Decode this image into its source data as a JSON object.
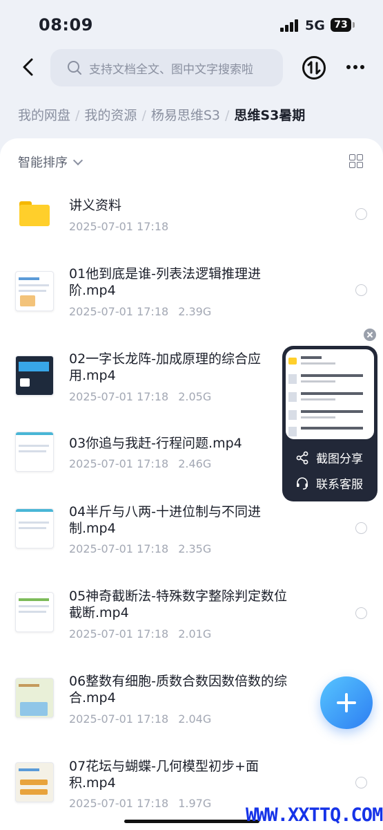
{
  "status_bar": {
    "time": "08:09",
    "network": "5G",
    "battery": "73"
  },
  "header": {
    "search_placeholder": "支持文档全文、图中文字搜索啦"
  },
  "breadcrumb": {
    "items": [
      "我的网盘",
      "我的资源",
      "杨易思维S3"
    ],
    "current": "思维S3暑期"
  },
  "toolbar": {
    "sort_label": "智能排序"
  },
  "files": [
    {
      "name": "讲义资料",
      "date": "2025-07-01 17:18",
      "size": "",
      "type": "folder"
    },
    {
      "name": "01他到底是谁-列表法逻辑推理进阶.mp4",
      "date": "2025-07-01 17:18",
      "size": "2.39G",
      "type": "video"
    },
    {
      "name": "02一字长龙阵-加成原理的综合应用.mp4",
      "date": "2025-07-01 17:18",
      "size": "2.05G",
      "type": "video"
    },
    {
      "name": "03你追与我赶-行程问题.mp4",
      "date": "2025-07-01 17:18",
      "size": "2.46G",
      "type": "video"
    },
    {
      "name": "04半斤与八两-十进位制与不同进制.mp4",
      "date": "2025-07-01 17:18",
      "size": "2.35G",
      "type": "video"
    },
    {
      "name": "05神奇截断法-特殊数字整除判定数位截断.mp4",
      "date": "2025-07-01 17:18",
      "size": "2.01G",
      "type": "video"
    },
    {
      "name": "06整数有细胞-质数合数因数倍数的综合.mp4",
      "date": "2025-07-01 17:18",
      "size": "2.04G",
      "type": "video"
    },
    {
      "name": "07花坛与蝴蝶-几何模型初步+面积.mp4",
      "date": "2025-07-01 17:18",
      "size": "1.97G",
      "type": "video"
    }
  ],
  "floating_panel": {
    "share_label": "截图分享",
    "service_label": "联系客服"
  },
  "watermark": "WWW.XXTTQ.COM",
  "colors": {
    "accent": "#2d7ef2",
    "folder": "#ffcf2b",
    "panel_bg": "#222838"
  },
  "icons": [
    "back-arrow-icon",
    "search-icon",
    "transfer-icon",
    "more-icon",
    "chevron-down-icon",
    "grid-view-icon",
    "folder-icon",
    "share-icon",
    "headset-icon",
    "close-icon",
    "plus-icon"
  ]
}
